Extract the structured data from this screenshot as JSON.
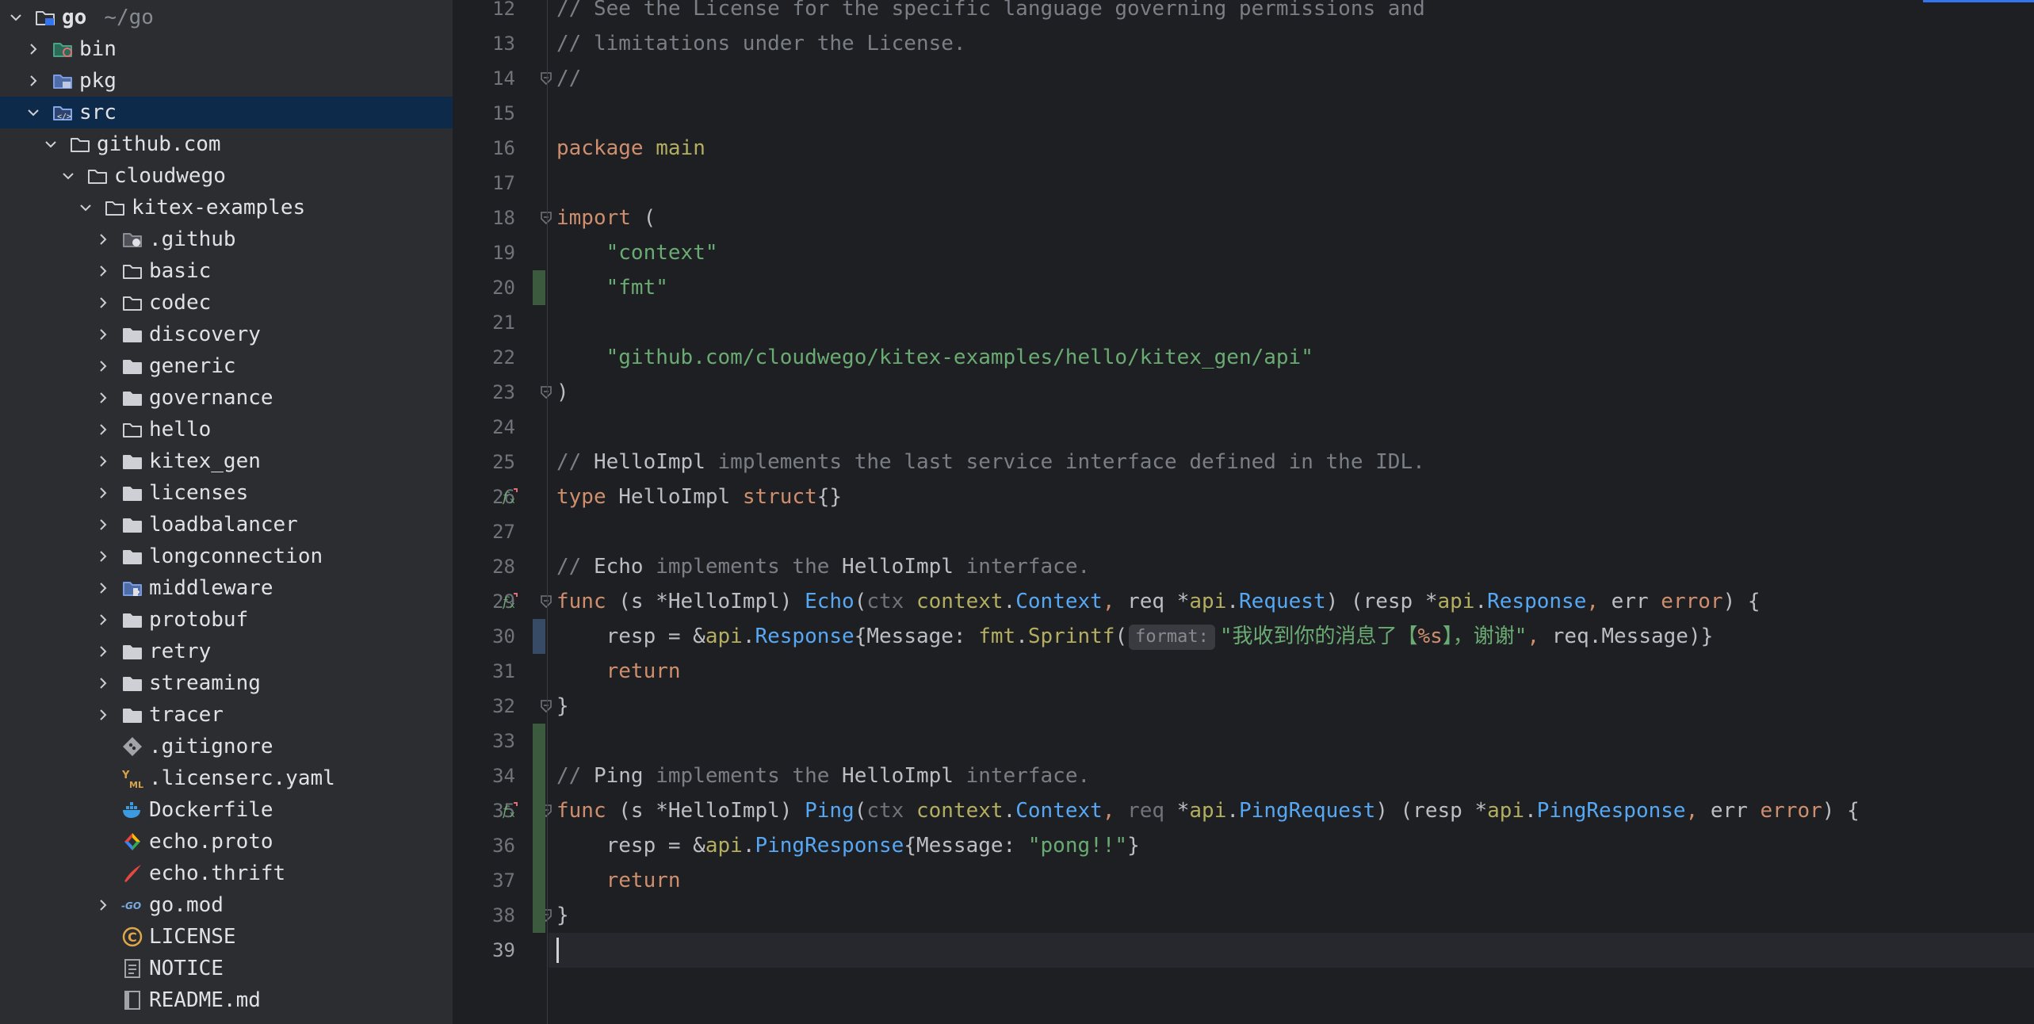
{
  "project_tree": {
    "rows": [
      {
        "label": "go",
        "hint": "~/go",
        "depth": 0,
        "chev": "down",
        "icon": "module-folder-icon",
        "selected": false,
        "bold": true
      },
      {
        "label": "bin",
        "depth": 1,
        "chev": "right",
        "icon": "excluded-folder-icon"
      },
      {
        "label": "pkg",
        "depth": 1,
        "chev": "right",
        "icon": "library-folder-icon"
      },
      {
        "label": "src",
        "depth": 1,
        "chev": "down",
        "icon": "source-folder-icon",
        "selected": true
      },
      {
        "label": "github.com",
        "depth": 2,
        "chev": "down",
        "icon": "folder-icon"
      },
      {
        "label": "cloudwego",
        "depth": 3,
        "chev": "down",
        "icon": "folder-icon"
      },
      {
        "label": "kitex-examples",
        "depth": 4,
        "chev": "down",
        "icon": "folder-icon"
      },
      {
        "label": ".github",
        "depth": 5,
        "chev": "right",
        "icon": "github-folder-icon"
      },
      {
        "label": "basic",
        "depth": 5,
        "chev": "right",
        "icon": "folder-icon"
      },
      {
        "label": "codec",
        "depth": 5,
        "chev": "right",
        "icon": "folder-icon"
      },
      {
        "label": "discovery",
        "depth": 5,
        "chev": "right",
        "icon": "package-folder-icon"
      },
      {
        "label": "generic",
        "depth": 5,
        "chev": "right",
        "icon": "package-folder-icon"
      },
      {
        "label": "governance",
        "depth": 5,
        "chev": "right",
        "icon": "package-folder-icon"
      },
      {
        "label": "hello",
        "depth": 5,
        "chev": "right",
        "icon": "folder-icon"
      },
      {
        "label": "kitex_gen",
        "depth": 5,
        "chev": "right",
        "icon": "package-folder-icon"
      },
      {
        "label": "licenses",
        "depth": 5,
        "chev": "right",
        "icon": "package-folder-icon"
      },
      {
        "label": "loadbalancer",
        "depth": 5,
        "chev": "right",
        "icon": "package-folder-icon"
      },
      {
        "label": "longconnection",
        "depth": 5,
        "chev": "right",
        "icon": "package-folder-icon"
      },
      {
        "label": "middleware",
        "depth": 5,
        "chev": "right",
        "icon": "plugin-folder-icon"
      },
      {
        "label": "protobuf",
        "depth": 5,
        "chev": "right",
        "icon": "package-folder-icon"
      },
      {
        "label": "retry",
        "depth": 5,
        "chev": "right",
        "icon": "package-folder-icon"
      },
      {
        "label": "streaming",
        "depth": 5,
        "chev": "right",
        "icon": "package-folder-icon"
      },
      {
        "label": "tracer",
        "depth": 5,
        "chev": "right",
        "icon": "package-folder-icon"
      },
      {
        "label": ".gitignore",
        "depth": 5,
        "chev": "none",
        "icon": "git-file-icon"
      },
      {
        "label": ".licenserc.yaml",
        "depth": 5,
        "chev": "none",
        "icon": "yaml-file-icon"
      },
      {
        "label": "Dockerfile",
        "depth": 5,
        "chev": "none",
        "icon": "docker-file-icon"
      },
      {
        "label": "echo.proto",
        "depth": 5,
        "chev": "none",
        "icon": "proto-file-icon"
      },
      {
        "label": "echo.thrift",
        "depth": 5,
        "chev": "none",
        "icon": "thrift-file-icon"
      },
      {
        "label": "go.mod",
        "depth": 5,
        "chev": "right",
        "icon": "gomod-file-icon"
      },
      {
        "label": "LICENSE",
        "depth": 5,
        "chev": "none",
        "icon": "license-file-icon"
      },
      {
        "label": "NOTICE",
        "depth": 5,
        "chev": "none",
        "icon": "text-file-icon"
      },
      {
        "label": "README.md",
        "depth": 5,
        "chev": "none",
        "icon": "markdown-file-icon"
      }
    ]
  },
  "editor": {
    "first_line": 12,
    "current_line": 39,
    "lines": [
      {
        "n": "12",
        "tokens": [
          [
            "com",
            "// See the License for the specific language governing permissions and"
          ]
        ]
      },
      {
        "n": "13",
        "tokens": [
          [
            "com",
            "// limitations under the License."
          ]
        ]
      },
      {
        "n": "14",
        "tokens": [
          [
            "com",
            "//"
          ]
        ],
        "fold": true
      },
      {
        "n": "15",
        "tokens": []
      },
      {
        "n": "16",
        "tokens": [
          [
            "kw",
            "package "
          ],
          [
            "ref",
            "main"
          ]
        ]
      },
      {
        "n": "17",
        "tokens": []
      },
      {
        "n": "18",
        "tokens": [
          [
            "kw",
            "import"
          ],
          [
            "plain",
            " ("
          ]
        ],
        "fold": true
      },
      {
        "n": "19",
        "tokens": [
          [
            "plain",
            "    "
          ],
          [
            "str",
            "\"context\""
          ]
        ]
      },
      {
        "n": "20",
        "tokens": [
          [
            "plain",
            "    "
          ],
          [
            "str",
            "\"fmt\""
          ]
        ]
      },
      {
        "n": "21",
        "tokens": []
      },
      {
        "n": "22",
        "tokens": [
          [
            "plain",
            "    "
          ],
          [
            "str",
            "\"github.com/cloudwego/kitex-examples/hello/kitex_gen/api\""
          ]
        ]
      },
      {
        "n": "23",
        "tokens": [
          [
            "plain",
            ")"
          ]
        ],
        "fold": true
      },
      {
        "n": "24",
        "tokens": []
      },
      {
        "n": "25",
        "tokens": [
          [
            "com",
            "// "
          ],
          [
            "plain",
            "HelloImpl"
          ],
          [
            "com",
            " implements the last service interface defined in the IDL."
          ]
        ]
      },
      {
        "n": "26",
        "tokens": [
          [
            "kw",
            "type "
          ],
          [
            "plain",
            "HelloImpl "
          ],
          [
            "kw",
            "struct"
          ],
          [
            "plain",
            "{}"
          ]
        ],
        "impl": true
      },
      {
        "n": "27",
        "tokens": []
      },
      {
        "n": "28",
        "tokens": [
          [
            "com",
            "// "
          ],
          [
            "plain",
            "Echo"
          ],
          [
            "com",
            " implements the "
          ],
          [
            "plain",
            "HelloImpl"
          ],
          [
            "com",
            " interface."
          ]
        ]
      },
      {
        "n": "29",
        "tokens": [
          [
            "kw",
            "func "
          ],
          [
            "plain",
            "(s *HelloImpl) "
          ],
          [
            "fn",
            "Echo"
          ],
          [
            "plain",
            "("
          ],
          [
            "dim",
            "ctx "
          ],
          [
            "ref",
            "context"
          ],
          [
            "plain",
            "."
          ],
          [
            "kwblue",
            "Context"
          ],
          [
            "kw",
            ", "
          ],
          [
            "plain",
            "req *"
          ],
          [
            "ref",
            "api"
          ],
          [
            "plain",
            "."
          ],
          [
            "kwblue",
            "Request"
          ],
          [
            "plain",
            ") (resp *"
          ],
          [
            "ref",
            "api"
          ],
          [
            "plain",
            "."
          ],
          [
            "kwblue",
            "Response"
          ],
          [
            "kw",
            ", "
          ],
          [
            "plain",
            "err "
          ],
          [
            "kw",
            "error"
          ],
          [
            "plain",
            ") {"
          ]
        ],
        "impl": true,
        "fold": true
      },
      {
        "n": "30",
        "tokens": [
          [
            "plain",
            "    resp = &"
          ],
          [
            "ref",
            "api"
          ],
          [
            "plain",
            "."
          ],
          [
            "kwblue",
            "Response"
          ],
          [
            "plain",
            "{Message: "
          ],
          [
            "ref",
            "fmt"
          ],
          [
            "plain",
            "."
          ],
          [
            "ref",
            "Sprintf"
          ],
          [
            "plain",
            "("
          ],
          [
            "hint",
            "format:"
          ],
          [
            "str",
            "\"我收到你的消息了【"
          ],
          [
            "kw",
            "%s"
          ],
          [
            "str",
            "】，谢谢\""
          ],
          [
            "kw",
            ", "
          ],
          [
            "plain",
            "req.Message)}"
          ]
        ]
      },
      {
        "n": "31",
        "tokens": [
          [
            "plain",
            "    "
          ],
          [
            "kw",
            "return"
          ]
        ]
      },
      {
        "n": "32",
        "tokens": [
          [
            "plain",
            "}"
          ]
        ],
        "fold": true
      },
      {
        "n": "33",
        "tokens": []
      },
      {
        "n": "34",
        "tokens": [
          [
            "com",
            "// "
          ],
          [
            "plain",
            "Ping"
          ],
          [
            "com",
            " implements the "
          ],
          [
            "plain",
            "HelloImpl"
          ],
          [
            "com",
            " interface."
          ]
        ]
      },
      {
        "n": "35",
        "tokens": [
          [
            "kw",
            "func "
          ],
          [
            "plain",
            "(s *HelloImpl) "
          ],
          [
            "fn",
            "Ping"
          ],
          [
            "plain",
            "("
          ],
          [
            "dim",
            "ctx "
          ],
          [
            "ref",
            "context"
          ],
          [
            "plain",
            "."
          ],
          [
            "kwblue",
            "Context"
          ],
          [
            "kw",
            ", "
          ],
          [
            "dim",
            "req "
          ],
          [
            "plain",
            "*"
          ],
          [
            "ref",
            "api"
          ],
          [
            "plain",
            "."
          ],
          [
            "kwblue",
            "PingRequest"
          ],
          [
            "plain",
            ") (resp *"
          ],
          [
            "ref",
            "api"
          ],
          [
            "plain",
            "."
          ],
          [
            "kwblue",
            "PingResponse"
          ],
          [
            "kw",
            ", "
          ],
          [
            "plain",
            "err "
          ],
          [
            "kw",
            "error"
          ],
          [
            "plain",
            ") {"
          ]
        ],
        "impl": true,
        "fold": true
      },
      {
        "n": "36",
        "tokens": [
          [
            "plain",
            "    resp = &"
          ],
          [
            "ref",
            "api"
          ],
          [
            "plain",
            "."
          ],
          [
            "kwblue",
            "PingResponse"
          ],
          [
            "plain",
            "{Message: "
          ],
          [
            "str",
            "\"pong!!\""
          ],
          [
            "plain",
            "}"
          ]
        ]
      },
      {
        "n": "37",
        "tokens": [
          [
            "plain",
            "    "
          ],
          [
            "kw",
            "return"
          ]
        ]
      },
      {
        "n": "38",
        "tokens": [
          [
            "plain",
            "}"
          ]
        ],
        "fold": true
      },
      {
        "n": "39",
        "tokens": []
      }
    ]
  },
  "colors": {
    "selection": "#2e436e",
    "folder": "#ced0d6",
    "keyword": "#cf8e6d",
    "string": "#6aab73",
    "comment": "#7a7e85",
    "function": "#56a8f5"
  }
}
